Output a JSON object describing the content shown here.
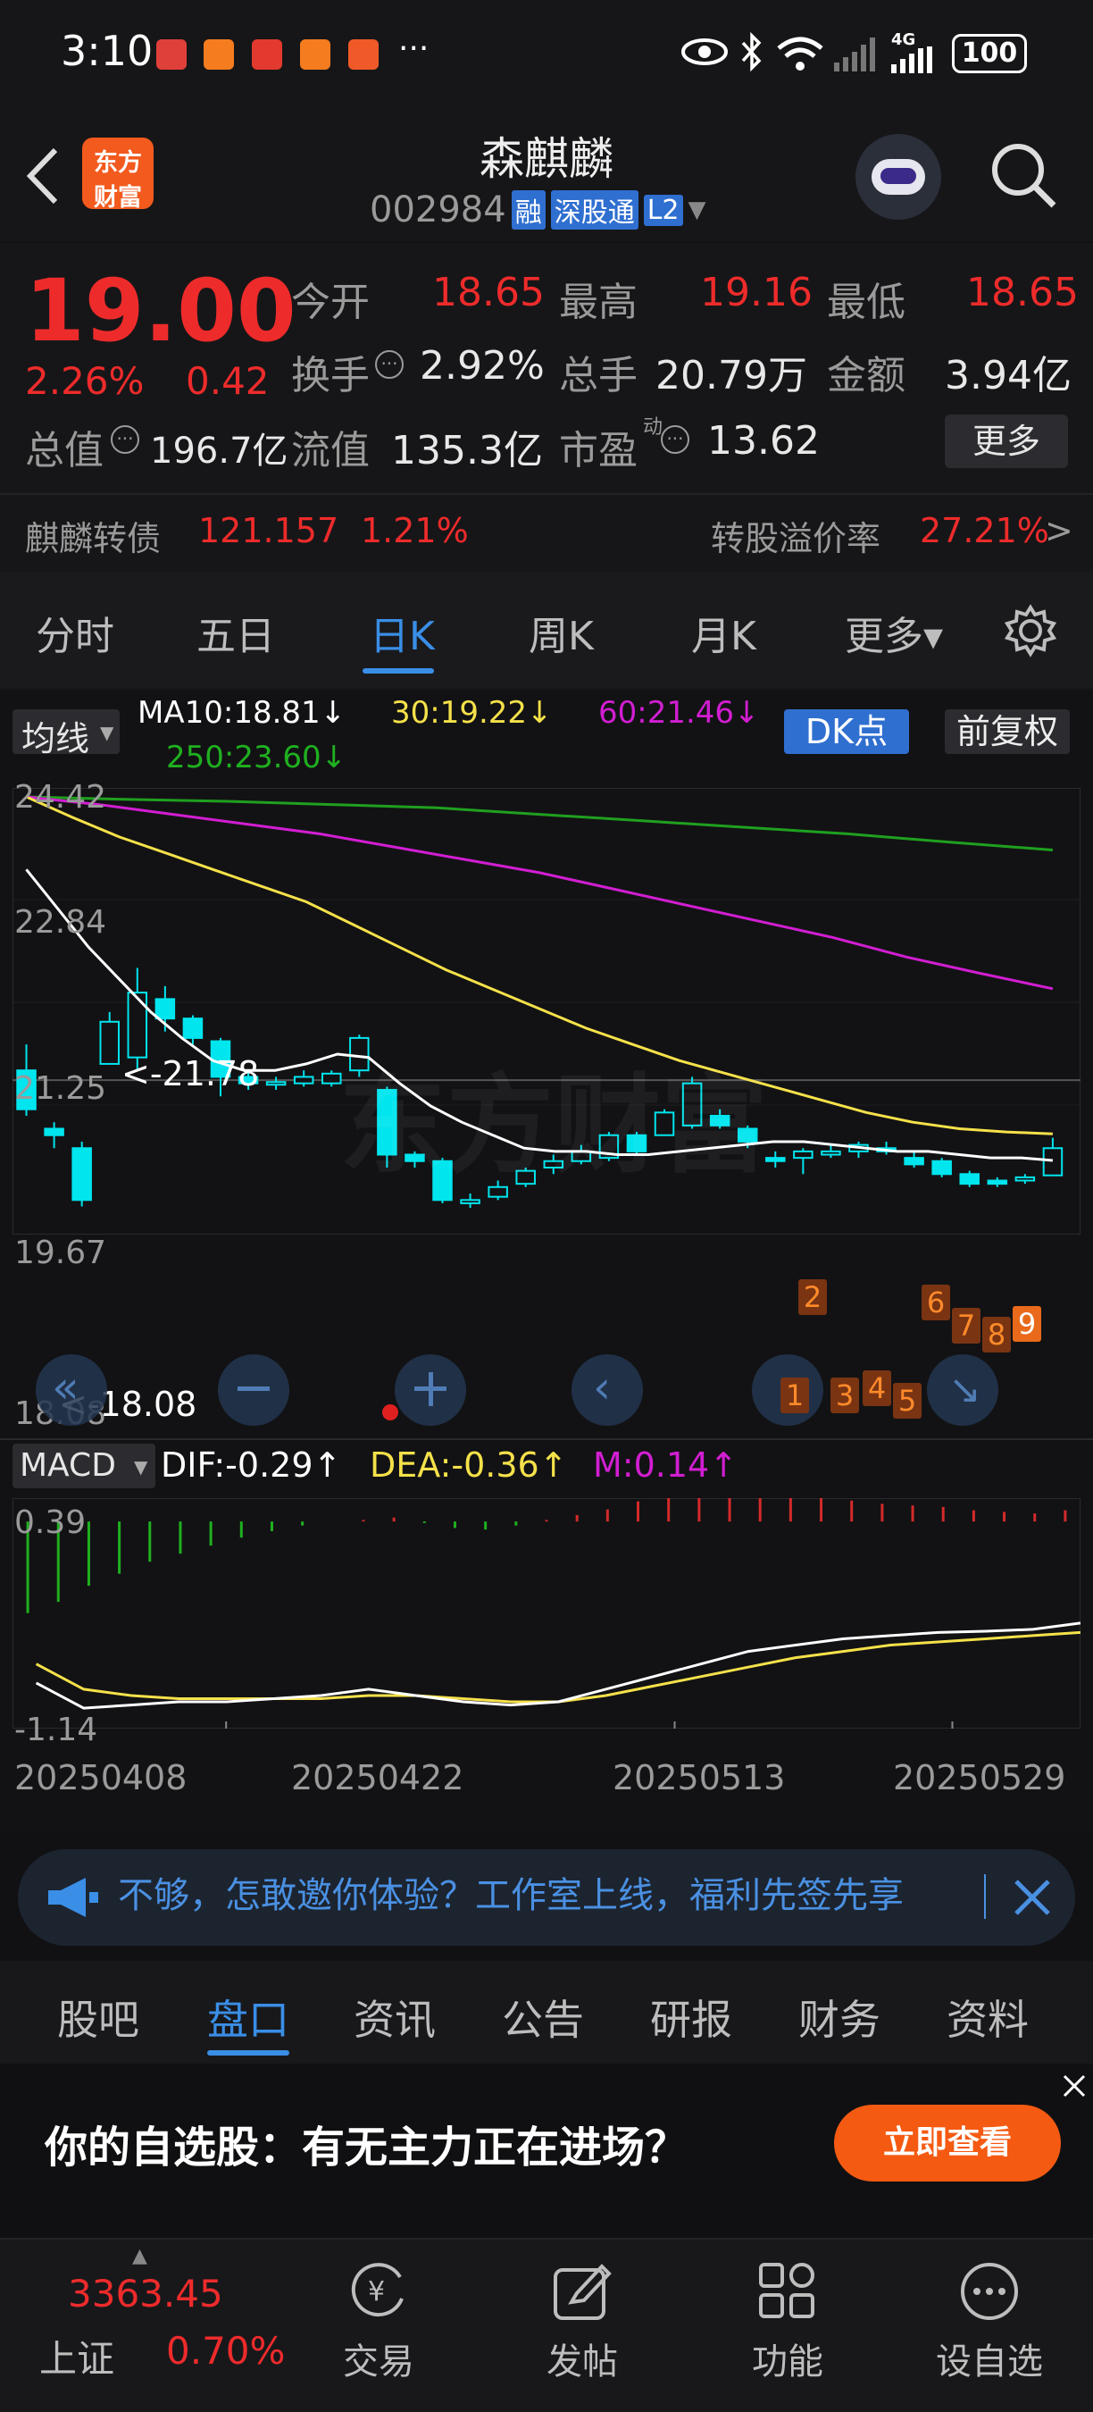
{
  "status": {
    "time": "3:10",
    "dots": "···",
    "net": "4G",
    "battery": "100"
  },
  "header": {
    "logo_line1": "东方",
    "logo_line2": "财富",
    "title": "森麒麟",
    "code": "002984",
    "badge_rong": "融",
    "badge_connect": "深股通",
    "badge_level": "L2"
  },
  "quote": {
    "price": "19.00",
    "change_pct": "2.26%",
    "change_amt": "0.42",
    "open_label": "今开",
    "open": "18.65",
    "high_label": "最高",
    "high": "19.16",
    "low_label": "最低",
    "low": "18.65",
    "turnover_label": "换手",
    "turnover": "2.92%",
    "volume_label": "总手",
    "volume": "20.79万",
    "amount_label": "金额",
    "amount": "3.94亿",
    "mktcap_label": "总值",
    "mktcap": "196.7亿",
    "float_label": "流值",
    "float": "135.3亿",
    "pe_label": "市盈",
    "pe_sup": "动",
    "pe": "13.62",
    "more": "更多"
  },
  "bond": {
    "name": "麒麟转债",
    "price": "121.157",
    "pct": "1.21%",
    "premium_label": "转股溢价率",
    "premium": "27.21%",
    "arrow": ">"
  },
  "tabs": [
    "分时",
    "五日",
    "日K",
    "周K",
    "月K",
    "更多▾"
  ],
  "ma": {
    "selector": "均线",
    "ma10": "MA10:18.81↓",
    "ma30": "30:19.22↓",
    "ma60": "60:21.46↓",
    "ma250": "250:23.60↓",
    "dk": "DK点",
    "fq": "前复权"
  },
  "price_axis": [
    "24.42",
    "22.84",
    "21.25",
    "19.67",
    "18.08"
  ],
  "annot_high": "<-21.78",
  "annot_low": "<-18.08",
  "macd": {
    "selector": "MACD",
    "dif": "DIF:-0.29↑",
    "dea": "DEA:-0.36↑",
    "m": "M:0.14↑",
    "axis_top": "0.39",
    "axis_bottom": "-1.14"
  },
  "dates": [
    "20250408",
    "20250422",
    "20250513",
    "20250529"
  ],
  "signals": [
    "1",
    "2",
    "3",
    "4",
    "5",
    "6",
    "7",
    "8",
    "9"
  ],
  "banner": {
    "text": "不够，怎敢邀你体验？工作室上线，福利先签先享"
  },
  "bottom_tabs": [
    "股吧",
    "盘口",
    "资讯",
    "公告",
    "研报",
    "财务",
    "资料"
  ],
  "ad": {
    "text": "你的自选股：有无主力正在进场？",
    "button": "立即查看"
  },
  "nav": {
    "index_value": "3363.45",
    "index_name": "上证",
    "index_pct": "0.70%",
    "trade": "交易",
    "post": "发帖",
    "func": "功能",
    "watch": "设自选"
  },
  "colors": {
    "up": "#ee2b2b",
    "down": "#00e5ee",
    "ma10": "#ffffff",
    "ma30": "#f5e14a",
    "ma60": "#d21ed2",
    "ma250": "#1fa01f",
    "accent": "#3a8ee6"
  },
  "chart_data": {
    "type": "candlestick",
    "candles": [
      {
        "o": 20.2,
        "c": 19.6,
        "h": 20.6,
        "l": 19.5
      },
      {
        "o": 19.3,
        "c": 19.2,
        "h": 19.4,
        "l": 19.0
      },
      {
        "o": 19.0,
        "c": 18.2,
        "h": 19.1,
        "l": 18.1
      },
      {
        "o": 20.3,
        "c": 20.95,
        "h": 21.1,
        "l": 20.3
      },
      {
        "o": 20.4,
        "c": 21.4,
        "h": 21.78,
        "l": 20.2
      },
      {
        "o": 21.3,
        "c": 21.0,
        "h": 21.5,
        "l": 20.8
      },
      {
        "o": 21.0,
        "c": 20.7,
        "h": 21.05,
        "l": 20.6
      },
      {
        "o": 20.65,
        "c": 20.1,
        "h": 20.7,
        "l": 19.8
      },
      {
        "o": 20.1,
        "c": 20.0,
        "h": 20.2,
        "l": 19.9
      },
      {
        "o": 19.98,
        "c": 20.02,
        "h": 20.1,
        "l": 19.9
      },
      {
        "o": 20.0,
        "c": 20.1,
        "h": 20.2,
        "l": 19.95
      },
      {
        "o": 20.0,
        "c": 20.15,
        "h": 20.2,
        "l": 19.95
      },
      {
        "o": 20.2,
        "c": 20.7,
        "h": 20.75,
        "l": 20.1
      },
      {
        "o": 19.9,
        "c": 18.9,
        "h": 19.95,
        "l": 18.7
      },
      {
        "o": 18.9,
        "c": 18.8,
        "h": 18.95,
        "l": 18.7
      },
      {
        "o": 18.8,
        "c": 18.2,
        "h": 18.85,
        "l": 18.15
      },
      {
        "o": 18.15,
        "c": 18.2,
        "h": 18.3,
        "l": 18.08
      },
      {
        "o": 18.25,
        "c": 18.4,
        "h": 18.5,
        "l": 18.2
      },
      {
        "o": 18.45,
        "c": 18.65,
        "h": 18.7,
        "l": 18.4
      },
      {
        "o": 18.7,
        "c": 18.8,
        "h": 18.9,
        "l": 18.6
      },
      {
        "o": 18.8,
        "c": 18.95,
        "h": 19.05,
        "l": 18.75
      },
      {
        "o": 18.85,
        "c": 19.2,
        "h": 19.25,
        "l": 18.8
      },
      {
        "o": 19.2,
        "c": 18.95,
        "h": 19.25,
        "l": 18.9
      },
      {
        "o": 19.2,
        "c": 19.55,
        "h": 19.6,
        "l": 19.2
      },
      {
        "o": 19.35,
        "c": 20.0,
        "h": 20.1,
        "l": 19.3
      },
      {
        "o": 19.5,
        "c": 19.35,
        "h": 19.6,
        "l": 19.3
      },
      {
        "o": 19.3,
        "c": 19.1,
        "h": 19.35,
        "l": 19.0
      },
      {
        "o": 18.85,
        "c": 18.8,
        "h": 18.95,
        "l": 18.7
      },
      {
        "o": 18.85,
        "c": 18.95,
        "h": 19.0,
        "l": 18.6
      },
      {
        "o": 18.9,
        "c": 18.95,
        "h": 19.05,
        "l": 18.85
      },
      {
        "o": 18.95,
        "c": 19.05,
        "h": 19.1,
        "l": 18.85
      },
      {
        "o": 19.0,
        "c": 18.95,
        "h": 19.1,
        "l": 18.9
      },
      {
        "o": 18.85,
        "c": 18.75,
        "h": 18.95,
        "l": 18.7
      },
      {
        "o": 18.8,
        "c": 18.6,
        "h": 18.85,
        "l": 18.55
      },
      {
        "o": 18.6,
        "c": 18.45,
        "h": 18.65,
        "l": 18.4
      },
      {
        "o": 18.5,
        "c": 18.45,
        "h": 18.55,
        "l": 18.4
      },
      {
        "o": 18.5,
        "c": 18.55,
        "h": 18.6,
        "l": 18.45
      },
      {
        "o": 18.58,
        "c": 19.0,
        "h": 19.16,
        "l": 18.58
      }
    ],
    "ma10": [
      23.3,
      22.7,
      22.1,
      21.6,
      21.1,
      20.7,
      20.35,
      20.2,
      20.2,
      20.3,
      20.45,
      20.4,
      20.0,
      19.65,
      19.4,
      19.2,
      19.0,
      18.95,
      18.95,
      18.9,
      18.9,
      18.95,
      19.0,
      19.05,
      19.1,
      19.1,
      19.05,
      19.0,
      18.95,
      18.95,
      18.9,
      18.85,
      18.85,
      18.81
    ],
    "ma30": [
      24.42,
      24.1,
      23.8,
      23.55,
      23.3,
      23.05,
      22.8,
      22.45,
      22.1,
      21.75,
      21.45,
      21.15,
      20.85,
      20.6,
      20.35,
      20.15,
      19.95,
      19.75,
      19.55,
      19.4,
      19.3,
      19.25,
      19.22
    ],
    "ma60": [
      24.42,
      24.3,
      24.15,
      24.0,
      23.85,
      23.65,
      23.45,
      23.25,
      23.0,
      22.75,
      22.5,
      22.25,
      21.95,
      21.7,
      21.46
    ],
    "ma250": [
      24.42,
      24.38,
      24.35,
      24.3,
      24.25,
      24.15,
      24.05,
      23.95,
      23.85,
      23.72,
      23.6
    ],
    "dif": [
      -0.7,
      -1.1,
      -1.05,
      -1.0,
      -1.0,
      -0.95,
      -0.9,
      -0.8,
      -0.9,
      -1.0,
      -1.05,
      -1.0,
      -0.8,
      -0.6,
      -0.4,
      -0.2,
      -0.1,
      0.0,
      0.05,
      0.1,
      0.12,
      0.15,
      0.25
    ],
    "dea": [
      -0.4,
      -0.8,
      -0.9,
      -0.95,
      -0.95,
      -0.95,
      -0.95,
      -0.9,
      -0.9,
      -0.95,
      -1.0,
      -1.0,
      -0.9,
      -0.75,
      -0.6,
      -0.45,
      -0.3,
      -0.2,
      -0.1,
      -0.05,
      0.0,
      0.05,
      0.1
    ],
    "macd_hist": [
      -1.14,
      -1.0,
      -0.8,
      -0.65,
      -0.5,
      -0.4,
      -0.3,
      -0.2,
      -0.12,
      -0.05,
      0.0,
      0.02,
      0.05,
      -0.02,
      -0.08,
      -0.1,
      -0.05,
      0.02,
      0.08,
      0.15,
      0.25,
      0.32,
      0.37,
      0.39,
      0.38,
      0.34,
      0.3,
      0.26,
      0.22,
      0.2,
      0.18,
      0.14,
      0.12,
      0.1,
      0.14
    ],
    "ylim": [
      18.08,
      24.42
    ],
    "macd_ylim": [
      -1.14,
      0.39
    ]
  }
}
